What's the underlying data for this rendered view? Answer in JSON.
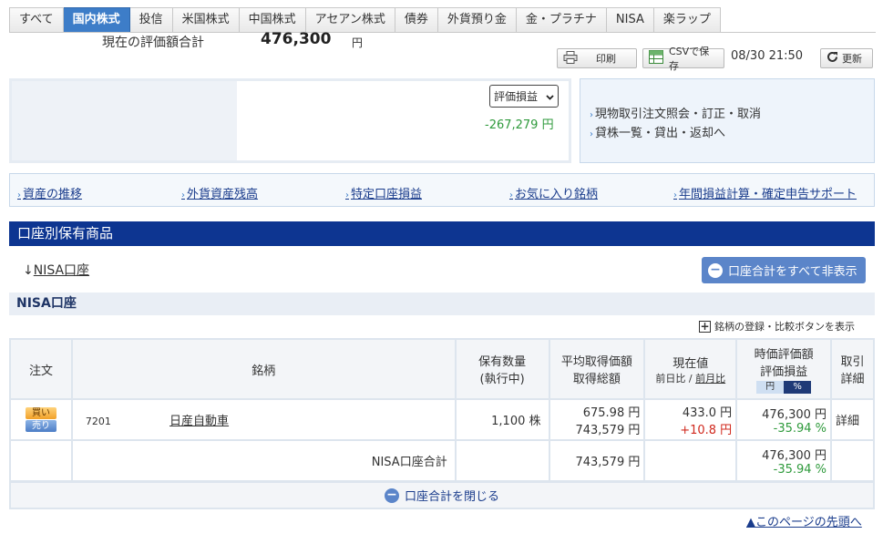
{
  "tabs": [
    "すべて",
    "国内株式",
    "投信",
    "米国株式",
    "中国株式",
    "アセアン株式",
    "債券",
    "外貨預り金",
    "金・プラチナ",
    "NISA",
    "楽ラップ"
  ],
  "toolbar": {
    "print_label": "印刷",
    "csv_label": "CSVで保存",
    "timestamp": "08/30 21:50",
    "refresh_label": "更新"
  },
  "summary": {
    "label": "現在の評価額合計",
    "value": "476,300",
    "unit": "円",
    "select_value": "評価損益",
    "diff": "-267,279 円"
  },
  "right_links": [
    "現物取引注文照会・訂正・取消",
    "貸株一覧・貸出・返却へ"
  ],
  "link_bar": [
    "資産の推移",
    "外貨資産残高",
    "特定口座損益",
    "お気に入り銘柄",
    "年間損益計算・確定申告サポート"
  ],
  "section_title": "口座別保有商品",
  "nisa_jump": {
    "arrow": "↓",
    "label": "NISA口座"
  },
  "hide_all_button": "口座合計をすべて非表示",
  "account_header": "NISA口座",
  "compare_link": "銘柄の登録・比較ボタンを表示",
  "table": {
    "headers": {
      "order": "注文",
      "name": "銘柄",
      "qty1": "保有数量",
      "qty2": "(執行中)",
      "avg1": "平均取得価額",
      "avg2": "取得総額",
      "price1": "現在値",
      "price_sub1": "前日比",
      "price_sep": "/",
      "price_sub2": "前月比",
      "eval1": "時価評価額",
      "eval2": "評価損益",
      "toggle_yen": "円",
      "toggle_pct": "%",
      "detail1": "取引",
      "detail2": "詳細"
    },
    "row": {
      "buy": "買い",
      "sell": "売り",
      "code": "7201",
      "name": "日産自動車",
      "qty": "1,100 株",
      "avg_price": "675.98 円",
      "total_cost": "743,579 円",
      "price": "433.0 円",
      "price_change": "+10.8 円",
      "market_value": "476,300 円",
      "pnl": "-35.94 %",
      "detail": "詳細"
    },
    "total": {
      "label": "NISA口座合計",
      "cost": "743,579 円",
      "market_value": "476,300 円",
      "pnl": "-35.94 %"
    }
  },
  "close_label": "口座合計を閉じる",
  "page_top_link": "▲このページの先頭へ"
}
